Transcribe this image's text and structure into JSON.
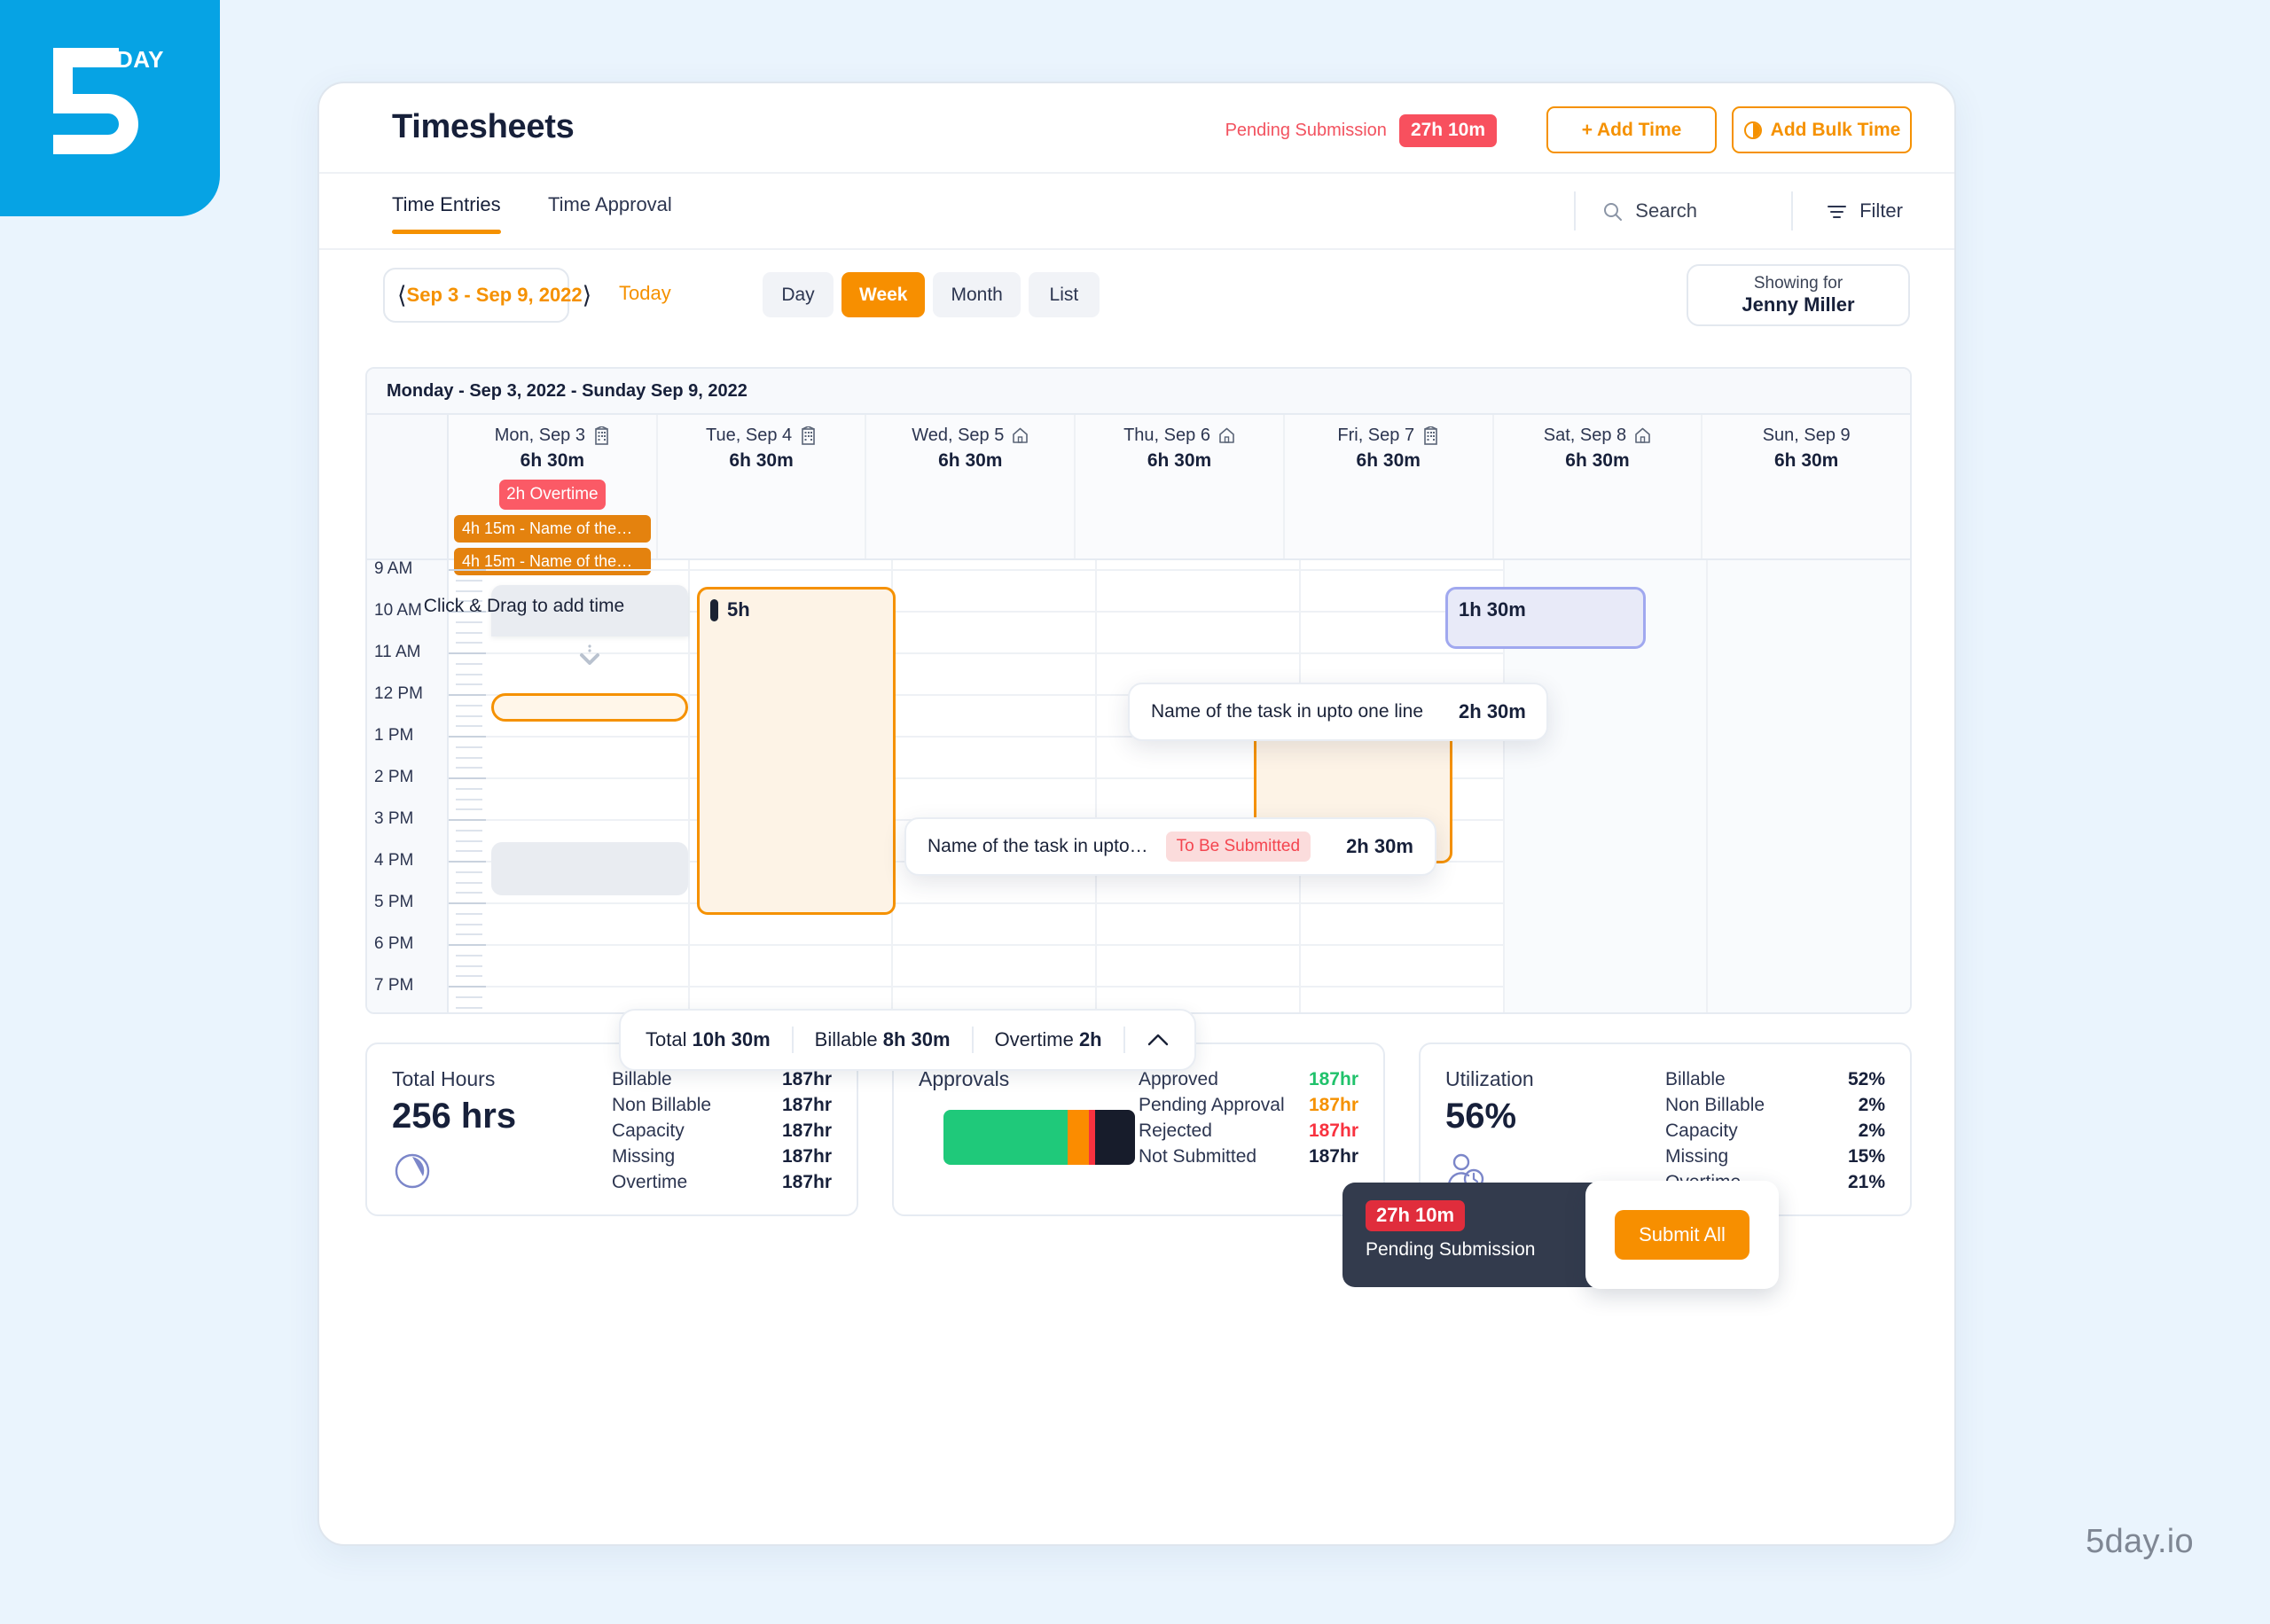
{
  "brand": {
    "logo_text": "DAY",
    "footer": "5day.io"
  },
  "header": {
    "title": "Timesheets",
    "pending_label": "Pending Submission",
    "pending_value": "27h 10m",
    "add_time_label": "+ Add Time",
    "add_bulk_label": "Add Bulk Time",
    "add_bulk_icon": "clock-icon"
  },
  "tabs": {
    "items": [
      {
        "label": "Time Entries",
        "active": true
      },
      {
        "label": "Time Approval",
        "active": false
      }
    ],
    "search_label": "Search",
    "search_icon": "search-icon",
    "filter_label": "Filter",
    "filter_icon": "filter-icon"
  },
  "toolbar": {
    "date_range": "Sep 3 - Sep 9, 2022",
    "prev_icon": "chevron-left-icon",
    "next_icon": "chevron-right-icon",
    "today_label": "Today",
    "views": [
      {
        "label": "Day",
        "active": false
      },
      {
        "label": "Week",
        "active": true
      },
      {
        "label": "Month",
        "active": false
      },
      {
        "label": "List",
        "active": false
      }
    ],
    "showing_for_label": "Showing for",
    "showing_for_name": "Jenny Miller"
  },
  "calendar": {
    "week_banner": "Monday - Sep 3, 2022 - Sunday Sep 9, 2022",
    "days": [
      {
        "name": "Mon, Sep 3",
        "hours": "6h 30m",
        "location_icon": "office-building-icon",
        "overtime_chip": "2h Overtime",
        "allday": [
          "4h 15m - Name of the…",
          "4h 15m - Name of the…"
        ]
      },
      {
        "name": "Tue, Sep 4",
        "hours": "6h 30m",
        "location_icon": "office-building-icon",
        "overtime_chip": null,
        "allday": []
      },
      {
        "name": "Wed, Sep 5",
        "hours": "6h 30m",
        "location_icon": "home-icon",
        "overtime_chip": null,
        "allday": []
      },
      {
        "name": "Thu, Sep 6",
        "hours": "6h 30m",
        "location_icon": "home-icon",
        "overtime_chip": null,
        "allday": []
      },
      {
        "name": "Fri, Sep 7",
        "hours": "6h 30m",
        "location_icon": "office-building-icon",
        "overtime_chip": null,
        "allday": []
      },
      {
        "name": "Sat, Sep 8",
        "hours": "6h 30m",
        "location_icon": "home-icon",
        "overtime_chip": null,
        "allday": []
      },
      {
        "name": "Sun, Sep 9",
        "hours": "6h 30m",
        "location_icon": null,
        "overtime_chip": null,
        "allday": []
      }
    ],
    "time_labels": [
      "9 AM",
      "10 AM",
      "11 AM",
      "12 PM",
      "1 PM",
      "2 PM",
      "3 PM",
      "4 PM",
      "5 PM",
      "6 PM",
      "7 PM"
    ],
    "drag_hint": "Click & Drag to add time",
    "drag_icon": "chevron-down-drag-icon",
    "events": [
      {
        "duration": "5h",
        "marker_color": "#1b2333",
        "day": "Tue, Sep 4"
      },
      {
        "duration": "1h 30m",
        "marker_color": null,
        "day": "Fri, Sep 7"
      },
      {
        "duration": "2h 30m",
        "marker_color": "#20c26b",
        "day": "Thu, Sep 6"
      }
    ],
    "popovers": [
      {
        "task": "Name of the task in upto one line",
        "status": null,
        "duration": "2h 30m",
        "note_icon": "note-icon",
        "billable_icon": "dollar-billable-icon",
        "actions": [
          "edit-icon",
          "delete-icon"
        ]
      },
      {
        "task": "Name of the task in upto…",
        "status": "To Be Submitted",
        "duration": "2h 30m",
        "note_icon": "note-icon",
        "billable_icon": "dollar-billable-icon",
        "actions": [
          "submit-arrow-icon",
          "edit-icon",
          "delete-icon"
        ]
      }
    ]
  },
  "totals_bar": {
    "total_label": "Total",
    "total_value": "10h 30m",
    "billable_label": "Billable",
    "billable_value": "8h 30m",
    "overtime_label": "Overtime",
    "overtime_value": "2h",
    "collapse_icon": "chevron-up-icon"
  },
  "submit_toast": {
    "amount": "27h 10m",
    "subtitle": "Pending Submission",
    "button_label": "Submit All"
  },
  "summary": {
    "total_hours": {
      "heading": "Total Hours",
      "big": "256 hrs",
      "icon": "pie-clock-icon",
      "rows": [
        {
          "k": "Billable",
          "v": "187hr"
        },
        {
          "k": "Non Billable",
          "v": "187hr"
        },
        {
          "k": "Capacity",
          "v": "187hr"
        },
        {
          "k": "Missing",
          "v": "187hr"
        },
        {
          "k": "Overtime",
          "v": "187hr"
        }
      ]
    },
    "approvals": {
      "heading": "Approvals",
      "bar": [
        {
          "color": "#1fc97a",
          "pct": 65
        },
        {
          "color": "#fb8c00",
          "pct": 11
        },
        {
          "color": "#f8323f",
          "pct": 3
        },
        {
          "color": "#171c2b",
          "pct": 21
        }
      ],
      "rows": [
        {
          "k": "Approved",
          "v": "187hr",
          "color": "#20c26b"
        },
        {
          "k": "Pending Approval",
          "v": "187hr",
          "color": "#f59100"
        },
        {
          "k": "Rejected",
          "v": "187hr",
          "color": "#f8323f"
        },
        {
          "k": "Not Submitted",
          "v": "187hr",
          "color": "#17203a"
        }
      ]
    },
    "utilization": {
      "heading": "Utilization",
      "big": "56%",
      "icon": "user-clock-icon",
      "rows": [
        {
          "k": "Billable",
          "v": "52%"
        },
        {
          "k": "Non Billable",
          "v": "2%"
        },
        {
          "k": "Capacity",
          "v": "2%"
        },
        {
          "k": "Missing",
          "v": "15%"
        },
        {
          "k": "Overtime",
          "v": "21%"
        }
      ]
    }
  },
  "chart_data": {
    "type": "bar",
    "title": "Approvals",
    "categories": [
      "Approved",
      "Pending Approval",
      "Rejected",
      "Not Submitted"
    ],
    "values": [
      187,
      187,
      187,
      187
    ],
    "segment_pcts": [
      65,
      11,
      3,
      21
    ],
    "colors": [
      "#20c26b",
      "#f59100",
      "#f8323f",
      "#17203a"
    ],
    "unit": "hr",
    "xlabel": "",
    "ylabel": "",
    "legend": "right"
  }
}
